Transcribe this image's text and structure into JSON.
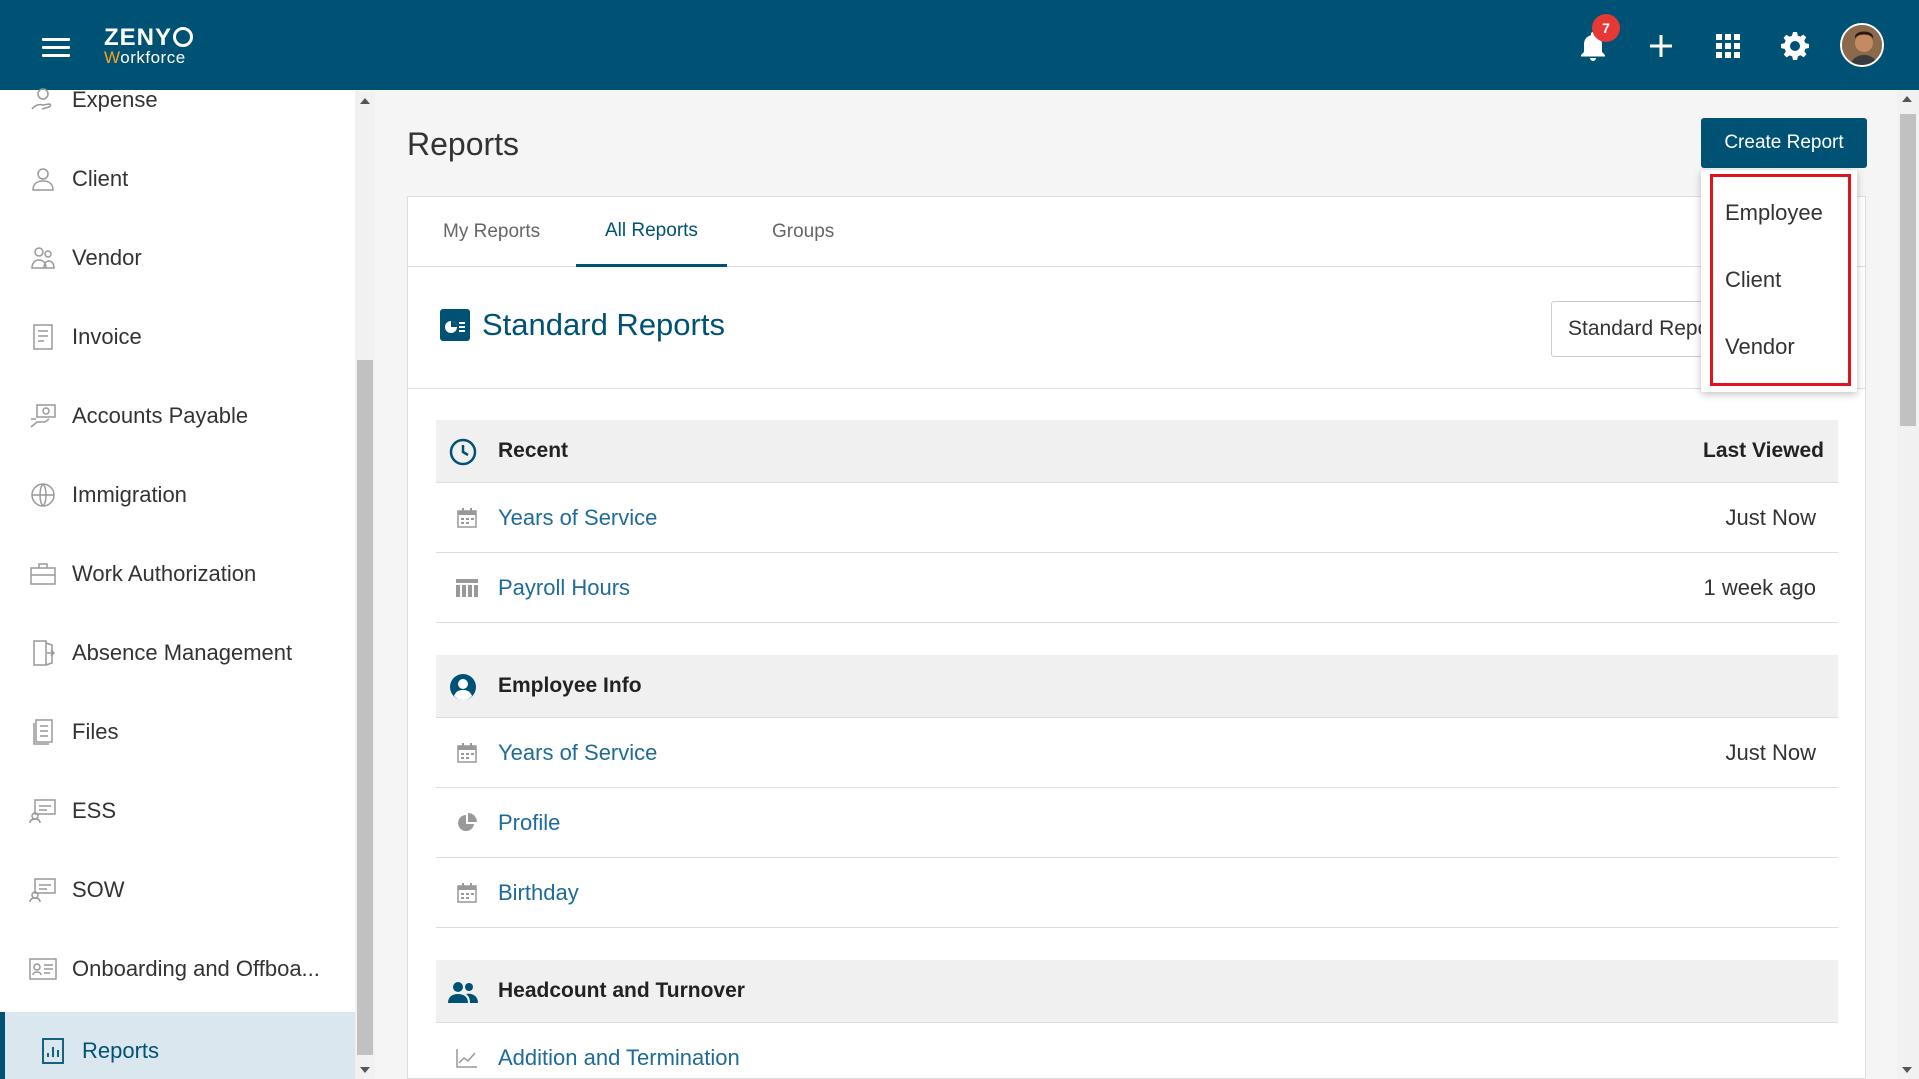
{
  "header": {
    "logo_line1": "ZENY",
    "logo_line2_w": "W",
    "logo_line2_rest": "orkforce",
    "notification_count": "7"
  },
  "sidebar": {
    "items": [
      {
        "label": "Expense",
        "icon": "expense-icon"
      },
      {
        "label": "Client",
        "icon": "client-icon"
      },
      {
        "label": "Vendor",
        "icon": "vendor-icon"
      },
      {
        "label": "Invoice",
        "icon": "invoice-icon"
      },
      {
        "label": "Accounts Payable",
        "icon": "accounts-payable-icon"
      },
      {
        "label": "Immigration",
        "icon": "immigration-icon"
      },
      {
        "label": "Work Authorization",
        "icon": "work-authorization-icon"
      },
      {
        "label": "Absence Management",
        "icon": "absence-icon"
      },
      {
        "label": "Files",
        "icon": "files-icon"
      },
      {
        "label": "ESS",
        "icon": "ess-icon"
      },
      {
        "label": "SOW",
        "icon": "sow-icon"
      },
      {
        "label": "Onboarding and Offboa...",
        "icon": "onboarding-icon"
      },
      {
        "label": "Reports",
        "icon": "reports-icon",
        "active": true
      }
    ]
  },
  "main": {
    "title": "Reports",
    "create_button": "Create Report",
    "tabs": [
      {
        "label": "My Reports"
      },
      {
        "label": "All Reports",
        "active": true
      },
      {
        "label": "Groups"
      }
    ],
    "standard_title": "Standard Reports",
    "standard_select": "Standard Reports",
    "sections": [
      {
        "title": "Recent",
        "right": "Last Viewed",
        "rows": [
          {
            "label": "Years of Service",
            "time": "Just Now"
          },
          {
            "label": "Payroll Hours",
            "time": "1 week ago"
          }
        ]
      },
      {
        "title": "Employee Info",
        "rows": [
          {
            "label": "Years of Service",
            "time": "Just Now"
          },
          {
            "label": "Profile",
            "time": ""
          },
          {
            "label": "Birthday",
            "time": ""
          }
        ]
      },
      {
        "title": "Headcount and Turnover",
        "rows": [
          {
            "label": "Addition and Termination",
            "time": ""
          }
        ]
      }
    ]
  },
  "dropdown": {
    "items": [
      "Employee",
      "Client",
      "Vendor"
    ]
  },
  "colors": {
    "brand": "#005274",
    "link": "#1e6b9a",
    "accent": "#f4a61d",
    "badge": "#e53935",
    "highlight": "#e0141e"
  }
}
